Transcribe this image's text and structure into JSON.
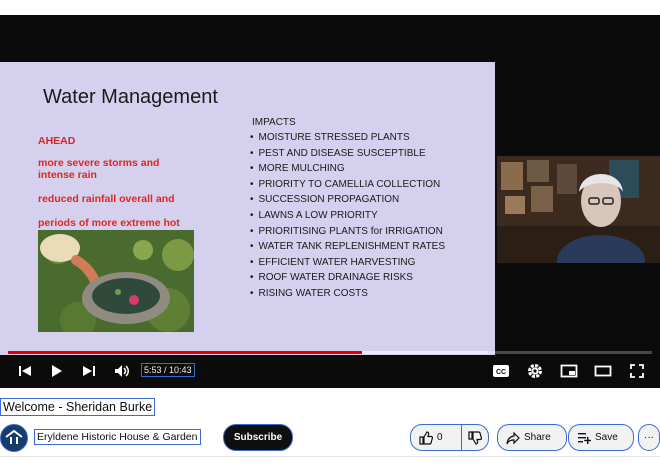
{
  "slide": {
    "title": "Water Management",
    "red_lines": [
      "AHEAD",
      "more severe storms  and intense rain",
      "reduced rainfall overall and",
      "periods of more extreme hot days"
    ],
    "impacts_heading": "IMPACTS",
    "impacts": [
      "MOISTURE STRESSED PLANTS",
      "PEST AND DISEASE SUSCEPTIBLE",
      "MORE MULCHING",
      "PRIORITY TO CAMELLIA COLLECTION",
      "SUCCESSION PROPAGATION",
      "LAWNS A LOW PRIORITY",
      "PRIORITISING PLANTS for IRRIGATION",
      "WATER TANK REPLENISHMENT RATES",
      "EFFICIENT WATER HARVESTING",
      "ROOF WATER DRAINAGE RISKS",
      "RISING WATER COSTS"
    ]
  },
  "player": {
    "time": "5:53 / 10:43",
    "progress_fraction": 0.549,
    "buffered_fraction": 0.745,
    "progress_color": "#e00000",
    "icons": [
      "previous-icon",
      "play-icon",
      "next-icon",
      "volume-icon",
      "captions-icon",
      "settings-icon",
      "miniplayer-icon",
      "theater-mode-icon",
      "fullscreen-icon"
    ]
  },
  "video": {
    "title": "Welcome - Sheridan Burke",
    "channel": "Eryldene Historic House & Garden",
    "subscribe_label": "Subscribe",
    "like_count": "0",
    "share_label": "Share",
    "save_label": "Save",
    "more_label": "···"
  }
}
